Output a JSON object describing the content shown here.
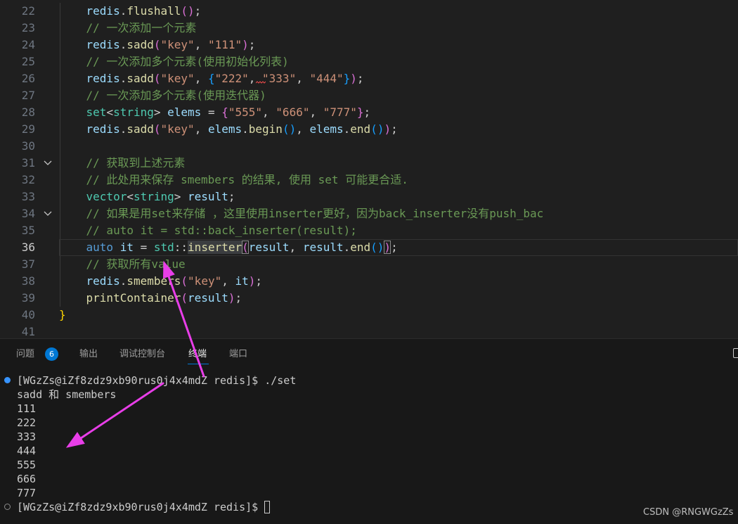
{
  "theme": {
    "editor_bg": "#1f1f1f",
    "panel_bg": "#181818",
    "accent": "#0078d4",
    "annotation": "#e83ee8"
  },
  "editor": {
    "lines": [
      {
        "num": "22",
        "tokens": [
          {
            "t": "    "
          },
          {
            "t": "redis",
            "c": "#9cdcfe"
          },
          {
            "t": "."
          },
          {
            "t": "flushall",
            "c": "#dcdcaa"
          },
          {
            "t": "()",
            "c": "#da70d6"
          },
          {
            "t": ";"
          }
        ]
      },
      {
        "num": "23",
        "tokens": [
          {
            "t": "    "
          },
          {
            "t": "// 一次添加一个元素",
            "c": "#6a9955"
          }
        ]
      },
      {
        "num": "24",
        "tokens": [
          {
            "t": "    "
          },
          {
            "t": "redis",
            "c": "#9cdcfe"
          },
          {
            "t": "."
          },
          {
            "t": "sadd",
            "c": "#dcdcaa"
          },
          {
            "t": "(",
            "c": "#da70d6"
          },
          {
            "t": "\"key\"",
            "c": "#ce9178"
          },
          {
            "t": ", "
          },
          {
            "t": "\"111\"",
            "c": "#ce9178"
          },
          {
            "t": ")",
            "c": "#da70d6"
          },
          {
            "t": ";"
          }
        ]
      },
      {
        "num": "25",
        "tokens": [
          {
            "t": "    "
          },
          {
            "t": "// 一次添加多个元素(使用初始化列表)",
            "c": "#6a9955"
          }
        ]
      },
      {
        "num": "26",
        "tokens": [
          {
            "t": "    "
          },
          {
            "t": "redis",
            "c": "#9cdcfe"
          },
          {
            "t": "."
          },
          {
            "t": "sadd",
            "c": "#dcdcaa"
          },
          {
            "t": "(",
            "c": "#da70d6"
          },
          {
            "t": "\"key\"",
            "c": "#ce9178"
          },
          {
            "t": ", "
          },
          {
            "t": "{",
            "c": "#179fff"
          },
          {
            "t": "\"222\"",
            "c": "#ce9178"
          },
          {
            "t": ", "
          },
          {
            "t": "\"333\"",
            "c": "#ce9178"
          },
          {
            "t": ", "
          },
          {
            "t": "\"444\"",
            "c": "#ce9178"
          },
          {
            "t": "}",
            "c": "#179fff"
          },
          {
            "t": ")",
            "c": "#da70d6"
          },
          {
            "t": ";"
          }
        ]
      },
      {
        "num": "27",
        "tokens": [
          {
            "t": "    "
          },
          {
            "t": "// 一次添加多个元素(使用迭代器)",
            "c": "#6a9955"
          }
        ]
      },
      {
        "num": "28",
        "tokens": [
          {
            "t": "    "
          },
          {
            "t": "set",
            "c": "#4ec9b0"
          },
          {
            "t": "<"
          },
          {
            "t": "string",
            "c": "#4ec9b0"
          },
          {
            "t": "> "
          },
          {
            "t": "elems",
            "c": "#9cdcfe"
          },
          {
            "t": " = "
          },
          {
            "t": "{",
            "c": "#da70d6"
          },
          {
            "t": "\"555\"",
            "c": "#ce9178"
          },
          {
            "t": ", "
          },
          {
            "t": "\"666\"",
            "c": "#ce9178"
          },
          {
            "t": ", "
          },
          {
            "t": "\"777\"",
            "c": "#ce9178"
          },
          {
            "t": "}",
            "c": "#da70d6"
          },
          {
            "t": ";"
          }
        ]
      },
      {
        "num": "29",
        "tokens": [
          {
            "t": "    "
          },
          {
            "t": "redis",
            "c": "#9cdcfe"
          },
          {
            "t": "."
          },
          {
            "t": "sadd",
            "c": "#dcdcaa"
          },
          {
            "t": "(",
            "c": "#da70d6"
          },
          {
            "t": "\"key\"",
            "c": "#ce9178"
          },
          {
            "t": ", "
          },
          {
            "t": "elems",
            "c": "#9cdcfe"
          },
          {
            "t": "."
          },
          {
            "t": "begin",
            "c": "#dcdcaa"
          },
          {
            "t": "()",
            "c": "#179fff"
          },
          {
            "t": ", "
          },
          {
            "t": "elems",
            "c": "#9cdcfe"
          },
          {
            "t": "."
          },
          {
            "t": "end",
            "c": "#dcdcaa"
          },
          {
            "t": "()",
            "c": "#179fff"
          },
          {
            "t": ")",
            "c": "#da70d6"
          },
          {
            "t": ";"
          }
        ]
      },
      {
        "num": "30",
        "tokens": []
      },
      {
        "num": "31",
        "fold": true,
        "tokens": [
          {
            "t": "    "
          },
          {
            "t": "// 获取到上述元素",
            "c": "#6a9955"
          }
        ]
      },
      {
        "num": "32",
        "tokens": [
          {
            "t": "    "
          },
          {
            "t": "// 此处用来保存 smembers 的结果, 使用 set 可能更合适.",
            "c": "#6a9955"
          }
        ]
      },
      {
        "num": "33",
        "tokens": [
          {
            "t": "    "
          },
          {
            "t": "vector",
            "c": "#4ec9b0"
          },
          {
            "t": "<"
          },
          {
            "t": "string",
            "c": "#4ec9b0"
          },
          {
            "t": "> "
          },
          {
            "t": "result",
            "c": "#9cdcfe"
          },
          {
            "t": ";"
          }
        ]
      },
      {
        "num": "34",
        "fold": true,
        "tokens": [
          {
            "t": "    "
          },
          {
            "t": "// 如果是用set来存储 ，这里使用inserter更好，因为back_inserter没有push_bac",
            "c": "#6a9955"
          }
        ]
      },
      {
        "num": "35",
        "tokens": [
          {
            "t": "    "
          },
          {
            "t": "// auto it = std::back_inserter(result);",
            "c": "#6a9955"
          }
        ]
      },
      {
        "num": "36",
        "active": true,
        "tokens": [
          {
            "t": "    "
          },
          {
            "t": "auto",
            "c": "#569cd6"
          },
          {
            "t": " "
          },
          {
            "t": "it",
            "c": "#9cdcfe"
          },
          {
            "t": " = "
          },
          {
            "t": "std",
            "c": "#4ec9b0"
          },
          {
            "t": "::"
          },
          {
            "t": "inserter",
            "c": "#dcdcaa",
            "word_hl": true
          },
          {
            "t": "(",
            "c": "#da70d6",
            "bracket_match": true
          },
          {
            "t": "result",
            "c": "#9cdcfe"
          },
          {
            "t": ", "
          },
          {
            "t": "result",
            "c": "#9cdcfe"
          },
          {
            "t": "."
          },
          {
            "t": "end",
            "c": "#dcdcaa"
          },
          {
            "t": "()",
            "c": "#179fff"
          },
          {
            "t": ")",
            "c": "#da70d6",
            "bracket_match": true
          },
          {
            "t": ";"
          }
        ]
      },
      {
        "num": "37",
        "tokens": [
          {
            "t": "    "
          },
          {
            "t": "// 获取所有value",
            "c": "#6a9955"
          }
        ]
      },
      {
        "num": "38",
        "tokens": [
          {
            "t": "    "
          },
          {
            "t": "redis",
            "c": "#9cdcfe"
          },
          {
            "t": "."
          },
          {
            "t": "smembers",
            "c": "#dcdcaa"
          },
          {
            "t": "(",
            "c": "#da70d6"
          },
          {
            "t": "\"key\"",
            "c": "#ce9178"
          },
          {
            "t": ", "
          },
          {
            "t": "it",
            "c": "#9cdcfe"
          },
          {
            "t": ")",
            "c": "#da70d6"
          },
          {
            "t": ";"
          }
        ]
      },
      {
        "num": "39",
        "tokens": [
          {
            "t": "    "
          },
          {
            "t": "printContainer",
            "c": "#dcdcaa"
          },
          {
            "t": "(",
            "c": "#da70d6"
          },
          {
            "t": "result",
            "c": "#9cdcfe"
          },
          {
            "t": ")",
            "c": "#da70d6"
          },
          {
            "t": ";"
          }
        ]
      },
      {
        "num": "40",
        "tokens": [
          {
            "t": "}",
            "c": "#ffd700"
          }
        ]
      },
      {
        "num": "41",
        "tokens": []
      }
    ]
  },
  "panel": {
    "tabs": [
      {
        "label": "问题",
        "badge": "6"
      },
      {
        "label": "输出"
      },
      {
        "label": "调试控制台"
      },
      {
        "label": "终端",
        "active": true
      },
      {
        "label": "端口"
      }
    ]
  },
  "terminal": {
    "lines": [
      {
        "icon": "filled-circle-icon",
        "text": "[WGzZs@iZf8zdz9xb90rus0j4x4mdZ redis]$ ./set"
      },
      {
        "text": "sadd 和 smembers"
      },
      {
        "text": "111"
      },
      {
        "text": "222"
      },
      {
        "text": "333"
      },
      {
        "text": "444"
      },
      {
        "text": "555"
      },
      {
        "text": "666"
      },
      {
        "text": "777"
      },
      {
        "icon": "hollow-circle-icon",
        "text": "[WGzZs@iZf8zdz9xb90rus0j4x4mdZ redis]$ ",
        "cursor": true
      }
    ]
  },
  "watermark": "CSDN @RNGWGzZs"
}
